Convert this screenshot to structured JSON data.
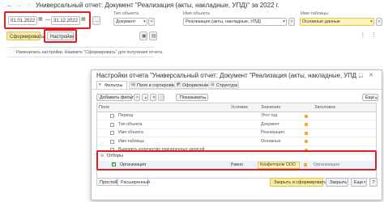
{
  "window": {
    "title": "Универсальный отчет: Документ \"Реализация (акты, накладные, УПД)\" за 2022 г."
  },
  "toolbar": {
    "period_start": "01.01.2022",
    "period_sep": "—",
    "period_end": "31.12.2022",
    "ellipsis": "...",
    "object_type_label": "Тип объекта",
    "object_type_value": "Документ",
    "object_name_label": "Имя объекта",
    "object_name_value": "Реализация (акты, накладные, УПД)",
    "table_name_label": "Имя таблицы",
    "table_name_value": "Основные данные",
    "generate_label": "Сформировать",
    "settings_label": "Настройки"
  },
  "hint": {
    "text": "Изменились настройки. Нажмите \"Сформировать\" для получения отчета."
  },
  "dialog": {
    "title": "Настройки отчета \"Универсальный отчет: Документ \"Реализация (акты, накладные, УПД ...",
    "tabs": [
      {
        "label": "Фильтры"
      },
      {
        "label": "Поля и сортировки"
      },
      {
        "label": "Оформление"
      },
      {
        "label": "Структура"
      }
    ],
    "add_filter_label": "Добавить фильтр",
    "show_label": "Показывать",
    "more_label": "Еще",
    "columns": {
      "field": "Поле",
      "condition": "Условие",
      "value": "Значение",
      "heading": "Заголовок"
    },
    "rows": [
      {
        "field": "Период",
        "condition": "",
        "value": "Этот год",
        "heading": ""
      },
      {
        "field": "Тип объекта",
        "condition": "",
        "value": "Документ",
        "heading": ""
      },
      {
        "field": "Имя объекта",
        "condition": "",
        "value": "Реализация",
        "heading": ""
      },
      {
        "field": "Имя таблицы",
        "condition": "",
        "value": "Основные",
        "heading": ""
      },
      {
        "field": "Выводить количество подчиненных записей",
        "condition": "",
        "value": "",
        "heading": ""
      }
    ],
    "selection_group": "Отборы",
    "selection_row": {
      "field": "Организация",
      "condition": "Равно",
      "value": "Конфетпром ООО",
      "heading": "Организация"
    },
    "footer_tabs": [
      {
        "label": "Простой"
      },
      {
        "label": "Расширенный"
      }
    ],
    "close_generate_label": "Закрыть и сформировать",
    "close_label": "Закрыть",
    "help_label": "?"
  }
}
